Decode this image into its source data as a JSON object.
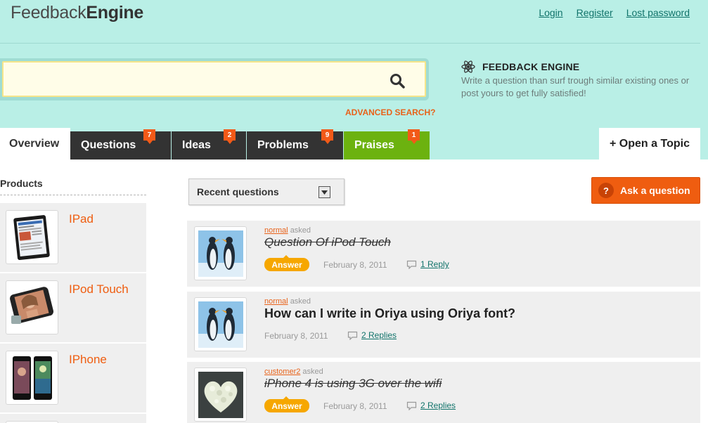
{
  "header": {
    "logo_light": "Feedback",
    "logo_bold": "Engine",
    "links": {
      "login": "Login",
      "register": "Register",
      "lost_password": "Lost password"
    }
  },
  "search": {
    "value": "",
    "placeholder": "",
    "advanced_label": "ADVANCED SEARCH?"
  },
  "info": {
    "title": "FEEDBACK ENGINE",
    "description": "Write a question than surf trough similar existing ones or post yours to get fully satisfied!"
  },
  "tabs": {
    "overview": {
      "label": "Overview"
    },
    "questions": {
      "label": "Questions",
      "count": "7"
    },
    "ideas": {
      "label": "Ideas",
      "count": "2"
    },
    "problems": {
      "label": "Problems",
      "count": "9"
    },
    "praises": {
      "label": "Praises",
      "count": "1"
    },
    "open_topic": "+ Open a Topic"
  },
  "sidebar": {
    "title": "Products",
    "products": [
      {
        "name": "IPad"
      },
      {
        "name": "IPod Touch"
      },
      {
        "name": "IPhone"
      }
    ]
  },
  "main": {
    "filter_label": "Recent questions",
    "ask_label": "Ask a question",
    "ask_icon": "?",
    "asked_word": "asked",
    "answer_label": "Answer",
    "questions": [
      {
        "user": "normal",
        "title": "Question Of iPod Touch",
        "date": "February 8, 2011",
        "replies": "1 Reply"
      },
      {
        "user": "normal",
        "title": "How can I write in Oriya using Oriya font?",
        "date": "February 8, 2011",
        "replies": "2 Replies"
      },
      {
        "user": "customer2",
        "title": "iPhone 4 is using 3G over the wifi",
        "date": "February 8, 2011",
        "replies": "2 Replies"
      }
    ]
  },
  "colors": {
    "header_bg": "#b9efe6",
    "tab_dark": "#333333",
    "tab_praises": "#6cb20f",
    "accent_orange": "#ef5d10",
    "badge": "#f25a18",
    "answer_badge": "#f6a700",
    "link_teal": "#10736a"
  }
}
